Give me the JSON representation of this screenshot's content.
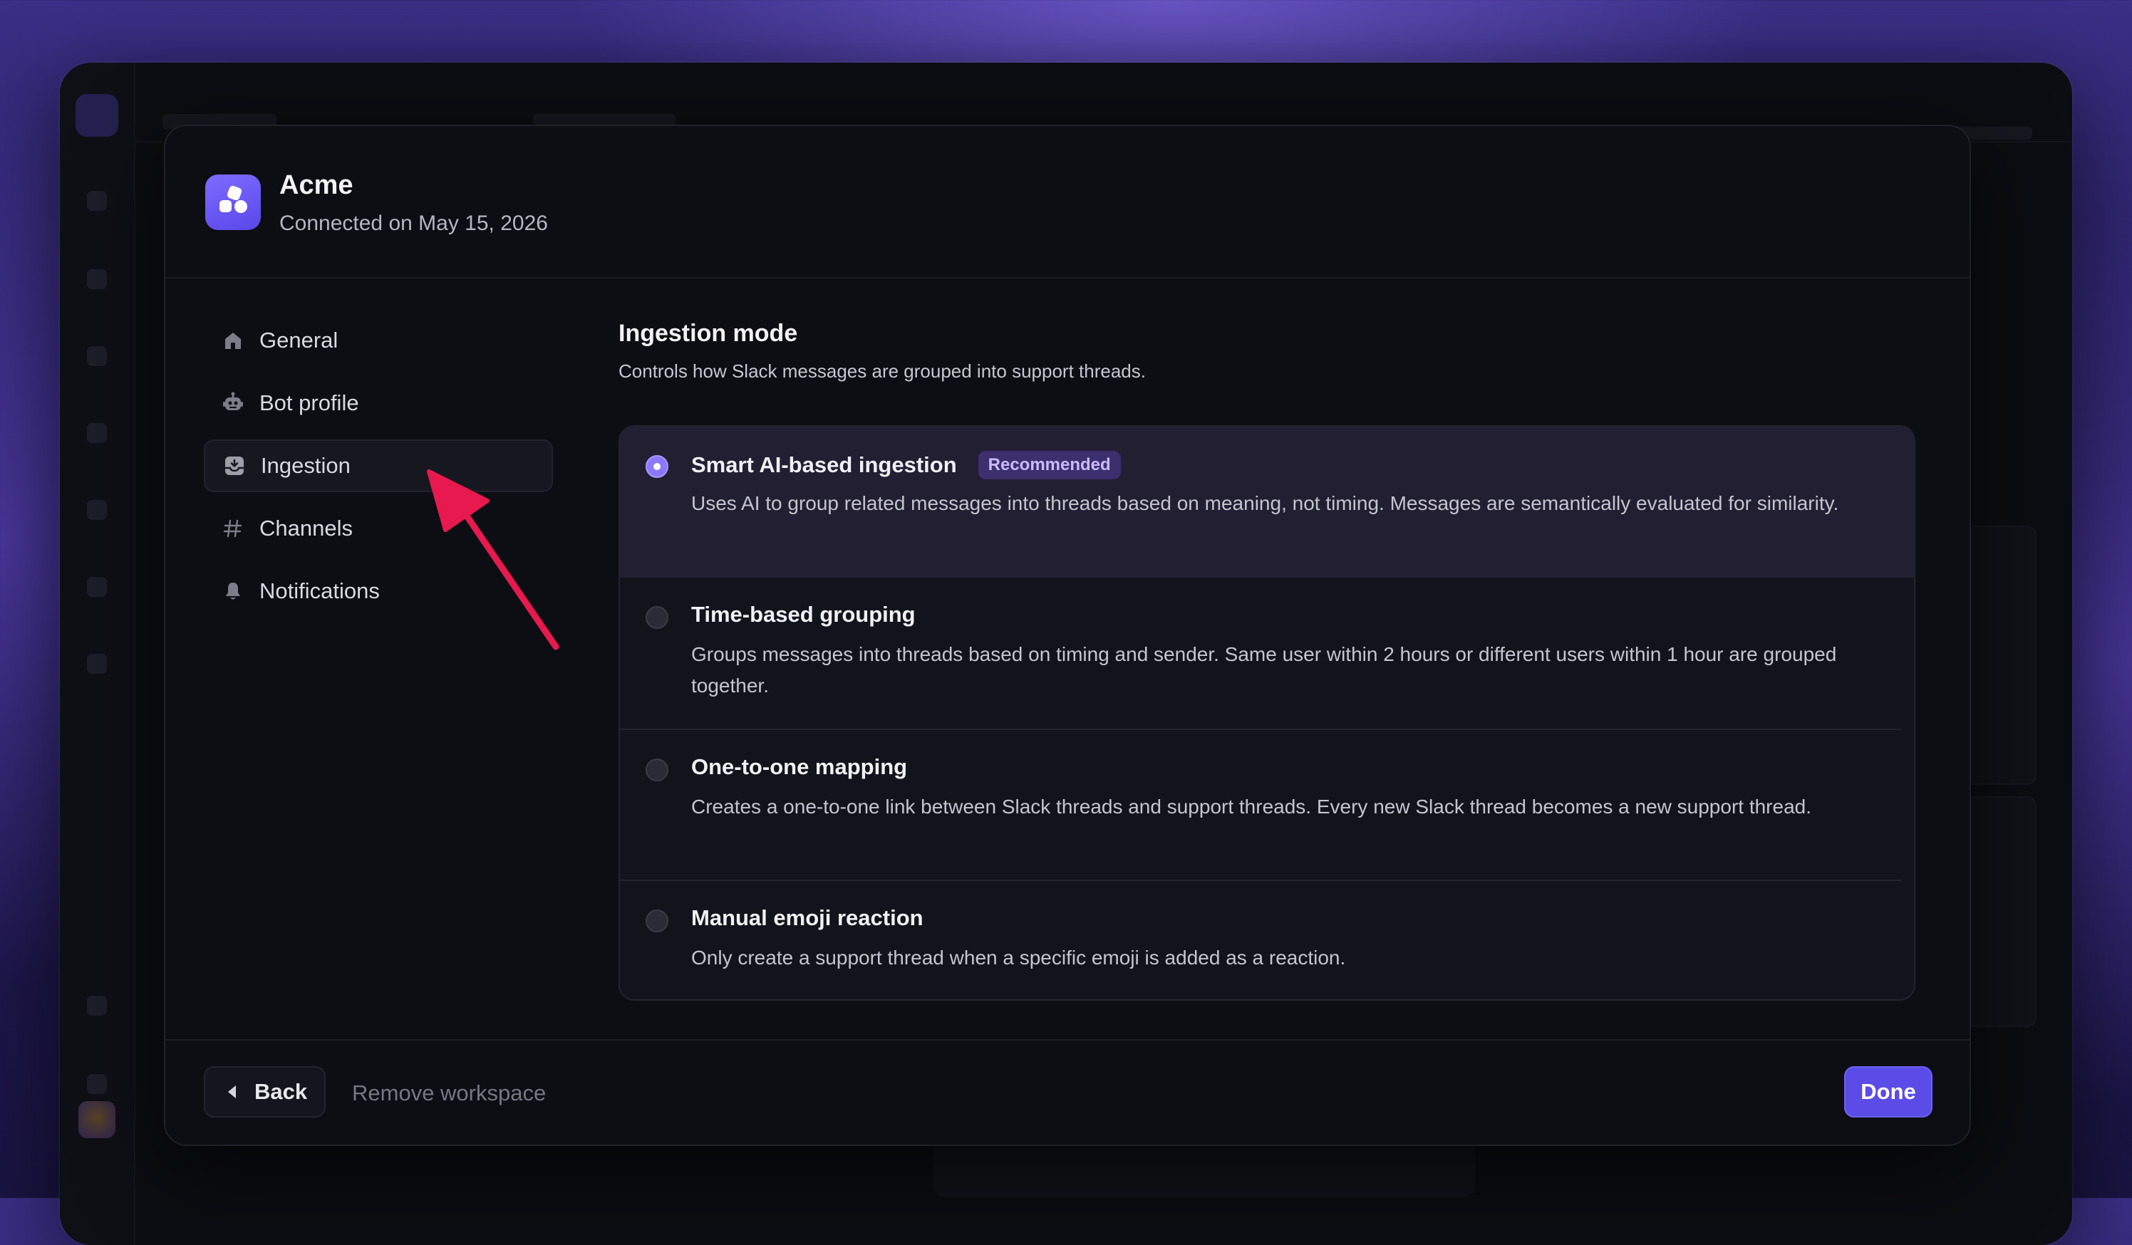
{
  "workspace": {
    "name": "Acme",
    "connected_text": "Connected on May 15, 2026"
  },
  "nav": {
    "items": [
      {
        "label": "General",
        "icon": "home-icon",
        "active": false
      },
      {
        "label": "Bot profile",
        "icon": "bot-icon",
        "active": false
      },
      {
        "label": "Ingestion",
        "icon": "inbox-icon",
        "active": true
      },
      {
        "label": "Channels",
        "icon": "hash-icon",
        "active": false
      },
      {
        "label": "Notifications",
        "icon": "bell-icon",
        "active": false
      }
    ]
  },
  "ingestion": {
    "title": "Ingestion mode",
    "description": "Controls how Slack messages are grouped into support threads.",
    "options": [
      {
        "title": "Smart AI-based ingestion",
        "badge": "Recommended",
        "description": "Uses AI to group related messages into threads based on meaning, not timing. Messages are semantically evaluated for similarity.",
        "selected": true
      },
      {
        "title": "Time-based grouping",
        "description": "Groups messages into threads based on timing and sender. Same user within 2 hours or different users within 1 hour are grouped together.",
        "selected": false
      },
      {
        "title": "One-to-one mapping",
        "description": "Creates a one-to-one link between Slack threads and support threads. Every new Slack thread becomes a new support thread.",
        "selected": false
      },
      {
        "title": "Manual emoji reaction",
        "description": "Only create a support thread when a specific emoji is added as a reaction.",
        "selected": false
      }
    ]
  },
  "footer": {
    "back_label": "Back",
    "remove_label": "Remove workspace",
    "done_label": "Done"
  },
  "colors": {
    "accent": "#5b4ce8",
    "selected_row": "#221f33",
    "annotation_arrow": "#e8194f"
  }
}
